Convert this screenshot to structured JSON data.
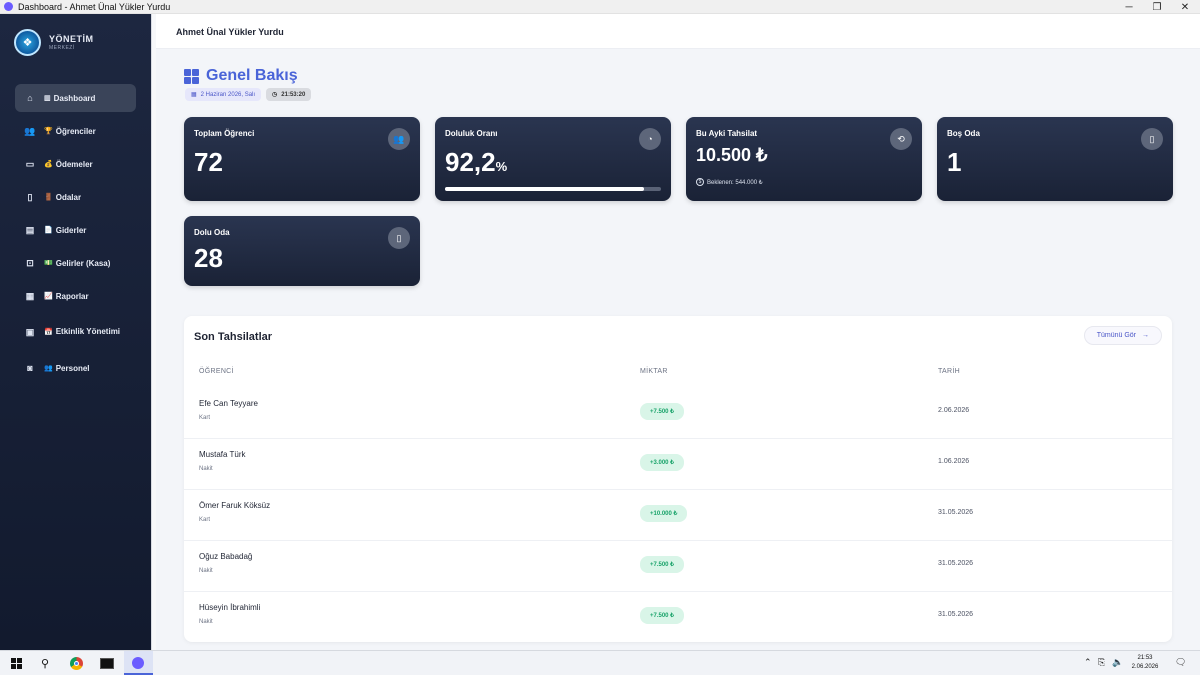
{
  "window": {
    "title": "Dashboard - Ahmet Ünal Yükler Yurdu",
    "minimize_glyph": "─",
    "maximize_glyph": "❐",
    "close_glyph": "✕"
  },
  "sidebar": {
    "brand_title": "YÖNETİM",
    "brand_subtitle": "MERKEZİ",
    "items": [
      {
        "icon": "home-icon",
        "glyph": "⌂",
        "emoji": "▥",
        "label": "Dashboard",
        "active": true
      },
      {
        "icon": "users-icon",
        "glyph": "👥",
        "emoji": "🏆",
        "label": "Öğrenciler"
      },
      {
        "icon": "money-icon",
        "glyph": "▭",
        "emoji": "💰",
        "label": "Ödemeler"
      },
      {
        "icon": "door-icon",
        "glyph": "▯",
        "emoji": "🚪",
        "label": "Odalar"
      },
      {
        "icon": "receipt-icon",
        "glyph": "▤",
        "emoji": "📄",
        "label": "Giderler"
      },
      {
        "icon": "income-icon",
        "glyph": "⊡",
        "emoji": "💵",
        "label": "Gelirler (Kasa)"
      },
      {
        "icon": "report-icon",
        "glyph": "▦",
        "emoji": "📈",
        "label": "Raporlar"
      },
      {
        "icon": "calendar-icon",
        "glyph": "▣",
        "emoji": "📅",
        "label": "Etkinlik Yönetimi"
      },
      {
        "icon": "staff-icon",
        "glyph": "◙",
        "emoji": "👥",
        "label": "Personel"
      }
    ]
  },
  "topbar": {
    "title": "Ahmet Ünal Yükler Yurdu"
  },
  "page": {
    "title": "Genel Bakış",
    "date": "2 Haziran 2026, Salı",
    "time": "21:53:20"
  },
  "stats": {
    "total_students": {
      "label": "Toplam Öğrenci",
      "value": "72",
      "icon": "users-icon"
    },
    "occupancy": {
      "label": "Doluluk Oranı",
      "value": "92,2",
      "unit": "%",
      "progress_percent": 92.2,
      "icon": "pie-chart-icon"
    },
    "monthly_collection": {
      "label": "Bu Ayki Tahsilat",
      "value": "10.500 ₺",
      "expected": "Beklenen: 544.000 ₺",
      "icon": "cash-icon"
    },
    "empty_rooms": {
      "label": "Boş Oda",
      "value": "1",
      "icon": "door-icon"
    },
    "full_rooms": {
      "label": "Dolu Oda",
      "value": "28",
      "icon": "door-icon"
    }
  },
  "recent": {
    "title": "Son Tahsilatlar",
    "see_all": "Tümünü Gör",
    "columns": [
      "ÖĞRENCİ",
      "MİKTAR",
      "TARİH"
    ],
    "rows": [
      {
        "name": "Efe Can Teyyare",
        "method": "Kart",
        "amount": "+7.500 ₺",
        "date": "2.06.2026"
      },
      {
        "name": "Mustafa Türk",
        "method": "Nakit",
        "amount": "+3.000 ₺",
        "date": "1.06.2026"
      },
      {
        "name": "Ömer Faruk Köksüz",
        "method": "Kart",
        "amount": "+10.000 ₺",
        "date": "31.05.2026"
      },
      {
        "name": "Oğuz Babadağ",
        "method": "Nakit",
        "amount": "+7.500 ₺",
        "date": "31.05.2026"
      },
      {
        "name": "Hüseyin İbrahimli",
        "method": "Nakit",
        "amount": "+7.500 ₺",
        "date": "31.05.2026"
      }
    ]
  },
  "taskbar": {
    "time": "21:53",
    "date": "2.06.2026"
  },
  "colors": {
    "accent": "#4a64d8",
    "sidebar": "#1d2740",
    "card": "#222c44",
    "success": "#19a36a"
  }
}
